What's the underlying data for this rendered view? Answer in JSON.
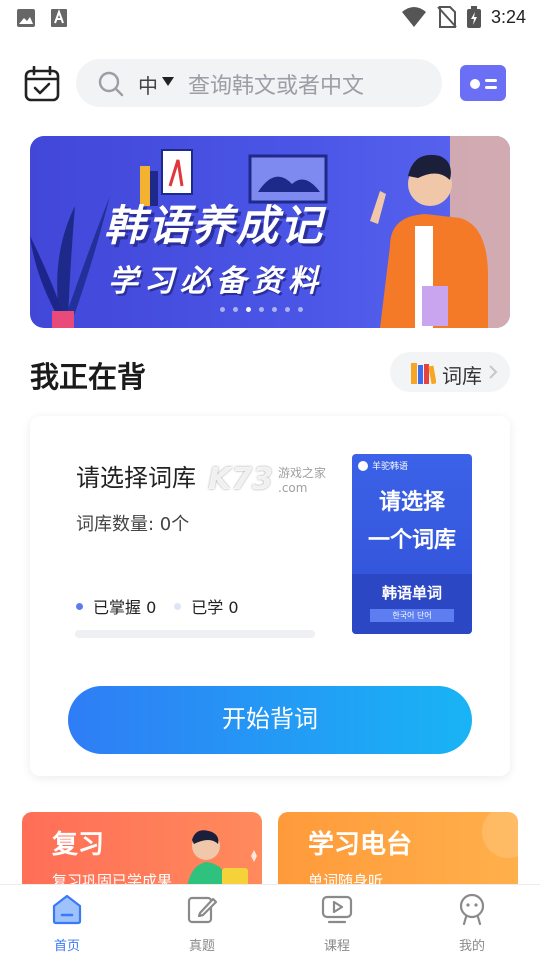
{
  "status_bar": {
    "time": "3:24"
  },
  "header": {
    "search_lang": "中",
    "search_placeholder": "查询韩文或者中文"
  },
  "banner": {
    "title": "韩语养成记",
    "subtitle": "学习必备资料",
    "slide_count": 7,
    "active_slide": 3
  },
  "section": {
    "title": "我正在背",
    "library_button": "词库"
  },
  "study_card": {
    "title": "请选择词库",
    "count_label": "词库数量: 0个",
    "mastered_label": "已掌握 0",
    "learned_label": "已学 0",
    "progress": 0,
    "book": {
      "brand": "羊驼韩语",
      "line1": "请选择",
      "line2": "一个词库",
      "subtitle": "韩语单词",
      "korean": "한국어 단어"
    },
    "start_button": "开始背词",
    "colors": {
      "mastered": "#5b7cf0",
      "learned": "#dfe5f7"
    }
  },
  "feature_cards": [
    {
      "title": "复习",
      "subtitle": "复习巩固已学成果"
    },
    {
      "title": "学习电台",
      "subtitle": "单词随身听"
    }
  ],
  "watermark": {
    "logo": "K73",
    "text": "游戏之家",
    "domain": ".com"
  },
  "tabs": [
    {
      "label": "首页",
      "icon": "home-icon",
      "active": true
    },
    {
      "label": "真题",
      "icon": "edit-icon",
      "active": false
    },
    {
      "label": "课程",
      "icon": "video-icon",
      "active": false
    },
    {
      "label": "我的",
      "icon": "profile-icon",
      "active": false
    }
  ],
  "accent_color": "#3a7af5"
}
